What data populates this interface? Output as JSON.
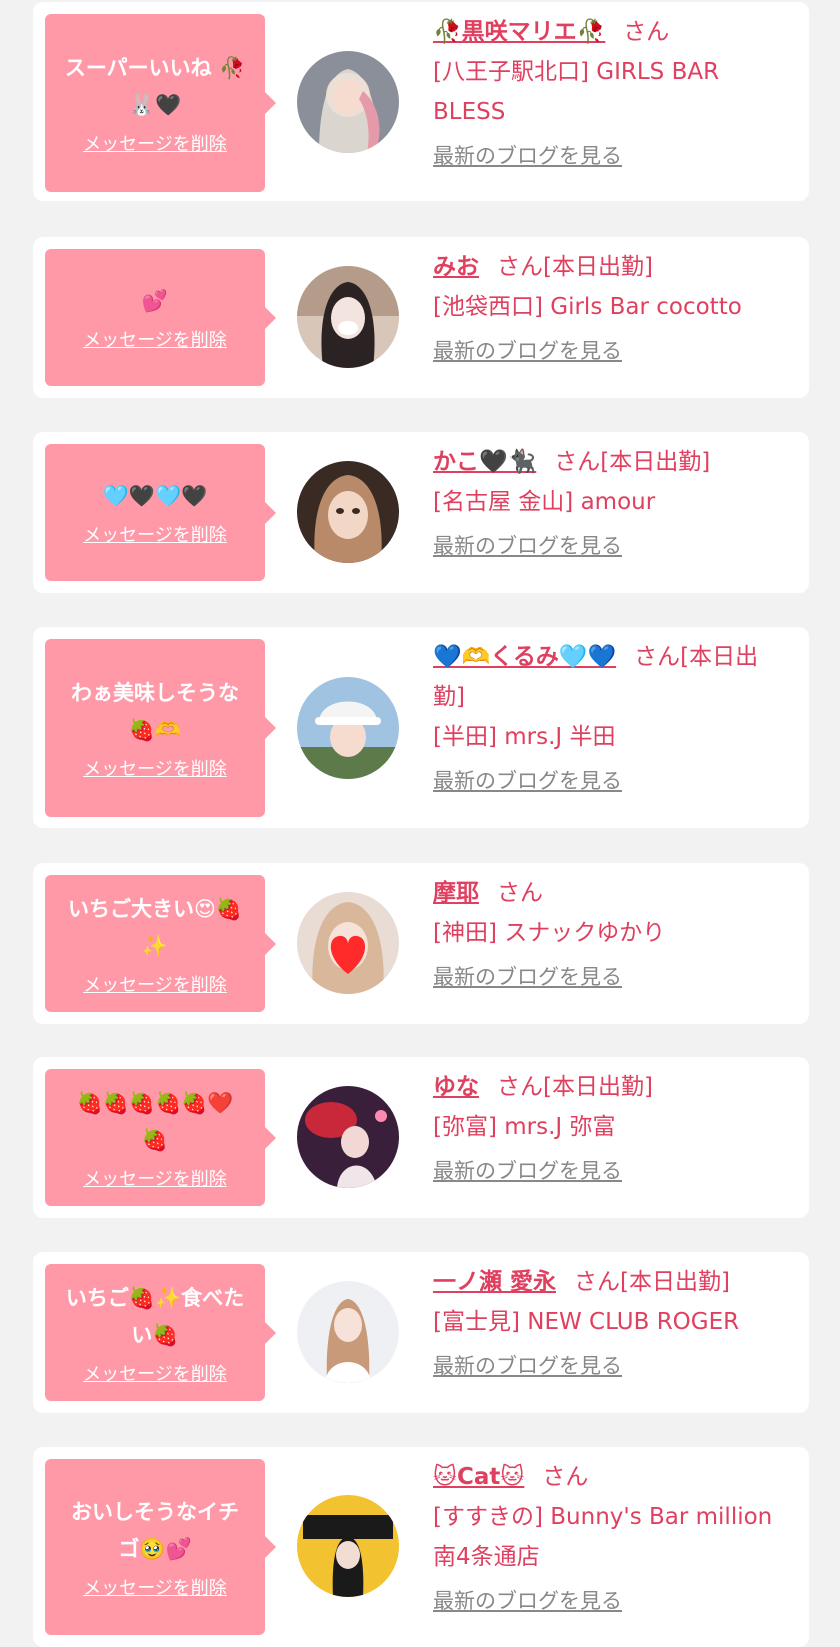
{
  "delete_label": "メッセージを削除",
  "blog_label": "最新のブログを見る",
  "colors": {
    "accent": "#e0405f",
    "bubble": "#ff99a8",
    "background": "#f2f2f2",
    "link_gray": "#888888"
  },
  "messages": [
    {
      "text": "スーパーいいね 🥀\n🐰🖤",
      "name": "🥀黒咲マリエ🥀",
      "suffix": "さん",
      "shop": "[八王子駅北口] GIRLS BAR BLESS"
    },
    {
      "text": "💕",
      "name": "みお",
      "suffix": "さん[本日出勤]",
      "shop": "[池袋西口] Girls Bar cocotto"
    },
    {
      "text": "🩵🖤🩵🖤",
      "name": "かこ🖤🐈‍⬛",
      "suffix": "さん[本日出勤]",
      "shop": "[名古屋 金山] amour"
    },
    {
      "text": "わぁ美味しそうな\n🍓🫶",
      "name": "💙🫶くるみ🩵💙",
      "suffix": "さん[本日出勤]",
      "shop": "[半田] mrs.J 半田"
    },
    {
      "text": "いちご大きい😍🍓\n✨",
      "name": "摩耶",
      "suffix": "さん",
      "shop": "[神田] スナックゆかり"
    },
    {
      "text": "🍓🍓🍓🍓🍓❤️\n🍓",
      "name": "ゆな",
      "suffix": "さん[本日出勤]",
      "shop": "[弥富] mrs.J 弥富"
    },
    {
      "text": "いちご🍓✨食べた\nい🍓",
      "name": "一ノ瀬 愛永",
      "suffix": "さん[本日出勤]",
      "shop": "[富士見] NEW CLUB ROGER"
    },
    {
      "text": "おいしそうなイチ\nゴ🥹💕",
      "name": "🐱Cat🐱",
      "suffix": "さん",
      "shop": "[すすきの] Bunny's Bar million 南4条通店"
    }
  ]
}
